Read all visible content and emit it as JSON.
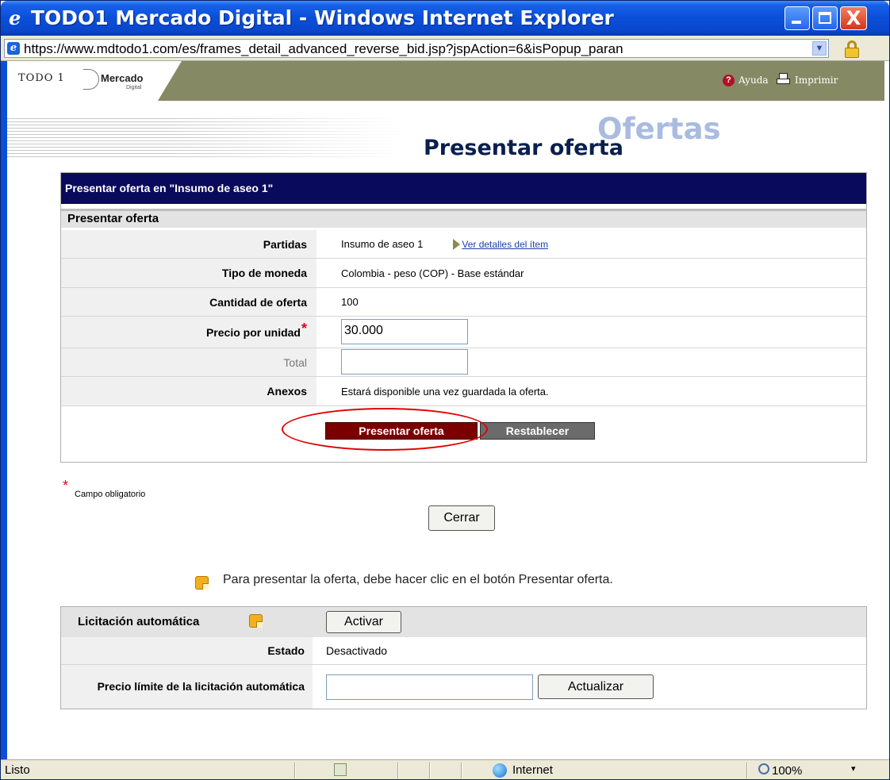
{
  "window": {
    "title": "TODO1 Mercado Digital - Windows Internet Explorer",
    "url": "https://www.mdtodo1.com/es/frames_detail_advanced_reverse_bid.jsp?jspAction=6&isPopup_paran",
    "minimize": "minimize",
    "maximize": "maximize",
    "close": "X"
  },
  "header": {
    "logo_todo": "TODO 1",
    "logo_mercado": "Mercado",
    "logo_digital": "Digital",
    "help": "Ayuda",
    "print": "Imprimir"
  },
  "page": {
    "watermark": "Ofertas",
    "title": "Presentar oferta"
  },
  "bid_form": {
    "header": "Presentar oferta en \"Insumo de aseo 1\"",
    "section": "Presentar oferta",
    "rows": [
      {
        "label": "Partidas",
        "value": "Insumo de aseo 1",
        "link": "Ver detalles del ítem"
      },
      {
        "label": "Tipo de moneda",
        "value": "Colombia - peso (COP) - Base estándar"
      },
      {
        "label": "Cantidad de oferta",
        "value": "100"
      },
      {
        "label": "Precio por unidad",
        "required_mark": "*",
        "input_value": "30.000"
      },
      {
        "label": "Total",
        "input_value": ""
      },
      {
        "label": "Anexos",
        "value": "Estará disponible una vez guardada la oferta."
      }
    ],
    "submit_label": "Presentar oferta",
    "reset_label": "Restablecer"
  },
  "required_note": {
    "star": "*",
    "text": "Campo obligatorio"
  },
  "close_label": "Cerrar",
  "info_text": "Para presentar la oferta, debe hacer clic en el botón Presentar oferta.",
  "auto_bid": {
    "header": "Licitación automática",
    "activate_label": "Activar",
    "status_label": "Estado",
    "status_value": "Desactivado",
    "limit_label": "Precio límite de la licitación automática",
    "limit_value": "",
    "update_label": "Actualizar"
  },
  "statusbar": {
    "text": "Listo",
    "zone": "Internet",
    "zoom": "100%",
    "zoom_arrow": "▾"
  },
  "colors": {
    "title_bar": "#0b4fd9",
    "header_bar": "#868a64",
    "form_header": "#0a0a5c",
    "submit_button": "#7a0000",
    "reset_button": "#6b6b6b",
    "highlight_ellipse": "#e00000",
    "required": "#e0001b"
  }
}
